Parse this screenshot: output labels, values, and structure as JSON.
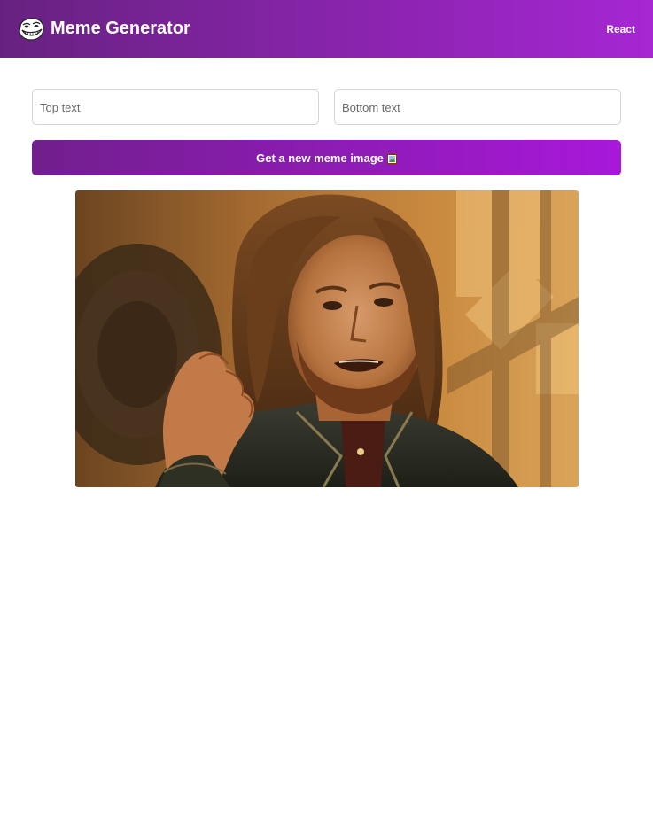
{
  "header": {
    "title": "Meme Generator",
    "subtitle": "React",
    "logo_icon": "troll-face-icon",
    "gradient_start": "#672280",
    "gradient_end": "#A626D3"
  },
  "form": {
    "top_text_placeholder": "Top text",
    "bottom_text_placeholder": "Bottom text",
    "top_text_value": "",
    "bottom_text_value": "",
    "button_label": "Get a new meme image",
    "button_icon": "framed-picture-icon"
  },
  "meme": {
    "image_subject": "one-does-not-simply-meme-image"
  }
}
